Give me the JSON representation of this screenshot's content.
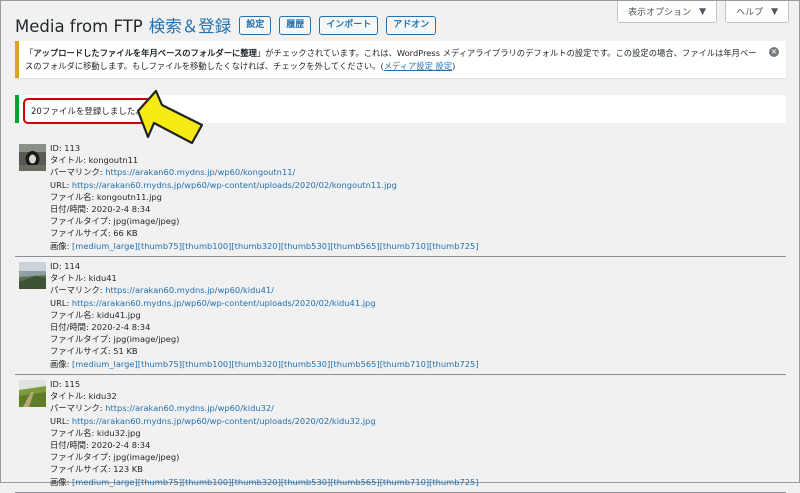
{
  "header": {
    "title": "Media from FTP",
    "subtitle": "検索＆登録",
    "buttons": [
      "設定",
      "履歴",
      "インポート",
      "アドオン"
    ]
  },
  "screen_tabs": {
    "options": "表示オプション",
    "help": "ヘルプ",
    "caret": "▼"
  },
  "notice_warning": {
    "line_start": "「",
    "bold": "アップロードしたファイルを年月ベースのフォルダーに整理",
    "after_bold": "」がチェックされています。これは、WordPress メディアライブラリのデフォルトの設定です。この設定の場合、ファイルは年月ベースのフォルダに移動します。もしファイルを移動したくなければ、チェックを外してください。(",
    "link": "メディア設定",
    "link2": "設定",
    "close": ")",
    "dismiss": "×"
  },
  "notice_success": {
    "text": "20ファイルを登録しました。"
  },
  "labels": {
    "id": "ID:",
    "title": "タイトル:",
    "permalink": "パーマリンク:",
    "url": "URL:",
    "filename": "ファイル名:",
    "datetime": "日付/時間:",
    "filetype": "ファイルタイプ:",
    "filesize": "ファイルサイズ:",
    "images": "画像:"
  },
  "image_sizes": [
    "[medium_large]",
    "[thumb75]",
    "[thumb100]",
    "[thumb320]",
    "[thumb530]",
    "[thumb565]",
    "[thumb710]",
    "[thumb725]"
  ],
  "items": [
    {
      "id": "113",
      "title": "kongoutn11",
      "permalink": "https://arakan60.mydns.jp/wp60/kongoutn11/",
      "url": "https://arakan60.mydns.jp/wp60/wp-content/uploads/2020/02/kongoutn11.jpg",
      "filename": "kongoutn11.jpg",
      "datetime": "2020-2-4 8:34",
      "filetype": "jpg(image/jpeg)",
      "filesize": "66 KB"
    },
    {
      "id": "114",
      "title": "kidu41",
      "permalink": "https://arakan60.mydns.jp/wp60/kidu41/",
      "url": "https://arakan60.mydns.jp/wp60/wp-content/uploads/2020/02/kidu41.jpg",
      "filename": "kidu41.jpg",
      "datetime": "2020-2-4 8:34",
      "filetype": "jpg(image/jpeg)",
      "filesize": "51 KB"
    },
    {
      "id": "115",
      "title": "kidu32",
      "permalink": "https://arakan60.mydns.jp/wp60/kidu32/",
      "url": "https://arakan60.mydns.jp/wp60/wp-content/uploads/2020/02/kidu32.jpg",
      "filename": "kidu32.jpg",
      "datetime": "2020-2-4 8:34",
      "filetype": "jpg(image/jpeg)",
      "filesize": "123 KB"
    }
  ]
}
